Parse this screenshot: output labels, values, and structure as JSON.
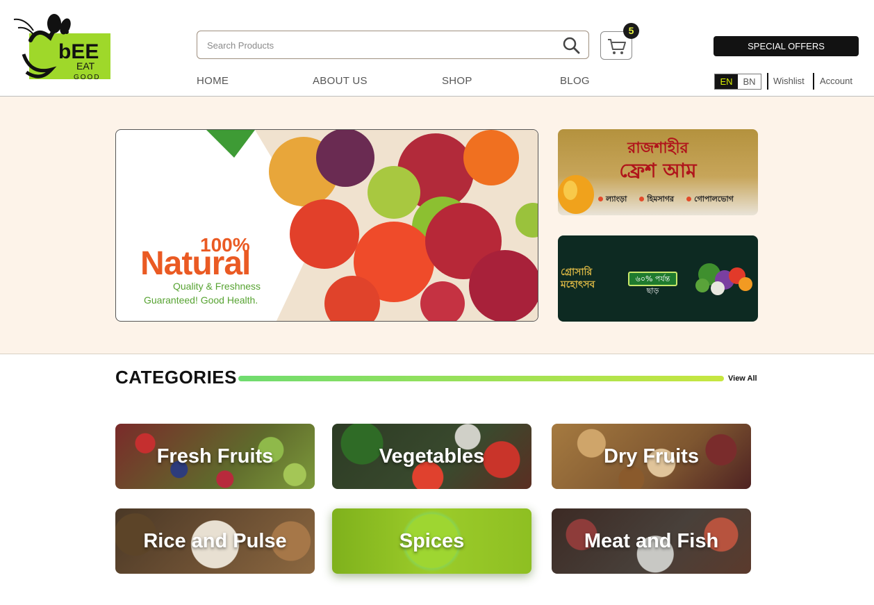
{
  "brand": {
    "logo_word": "bEE",
    "logo_eat": "EAT",
    "logo_good": "GOOD"
  },
  "search": {
    "placeholder": "Search Products"
  },
  "cart": {
    "count": "5"
  },
  "special_offers": "SPECIAL OFFERS",
  "nav": {
    "home": "HOME",
    "about": "ABOUT US",
    "shop": "SHOP",
    "blog": "BLOG"
  },
  "language": {
    "en": "EN",
    "bn": "BN",
    "selected": "EN"
  },
  "utility": {
    "wishlist": "Wishlist",
    "account": "Account"
  },
  "hero": {
    "main": {
      "percent": "100%",
      "headline": "Natural",
      "tagline1": "Quality & Freshness",
      "tagline2": "Guaranteed! Good Health."
    },
    "mango": {
      "title_line1": "রাজশাহীর",
      "title_line2": "ফ্রেশ আম",
      "items": [
        "ল্যাংড়া",
        "হিমসাগর",
        "গোপালভোগ"
      ]
    },
    "grocery": {
      "title": "গ্রোসারি মহোৎসব",
      "discount": "৬০% পর্যন্ত ছাড়"
    }
  },
  "categories": {
    "title": "CATEGORIES",
    "view_all": "View All",
    "items": [
      {
        "label": "Fresh Fruits"
      },
      {
        "label": "Vegetables"
      },
      {
        "label": "Dry Fruits"
      },
      {
        "label": "Rice and Pulse"
      },
      {
        "label": "Spices"
      },
      {
        "label": "Meat and Fish"
      }
    ]
  },
  "colors": {
    "accent_green": "#c7e640",
    "brand_orange": "#ea5a23",
    "dark": "#121212",
    "hero_bg": "#fdf3e9"
  }
}
